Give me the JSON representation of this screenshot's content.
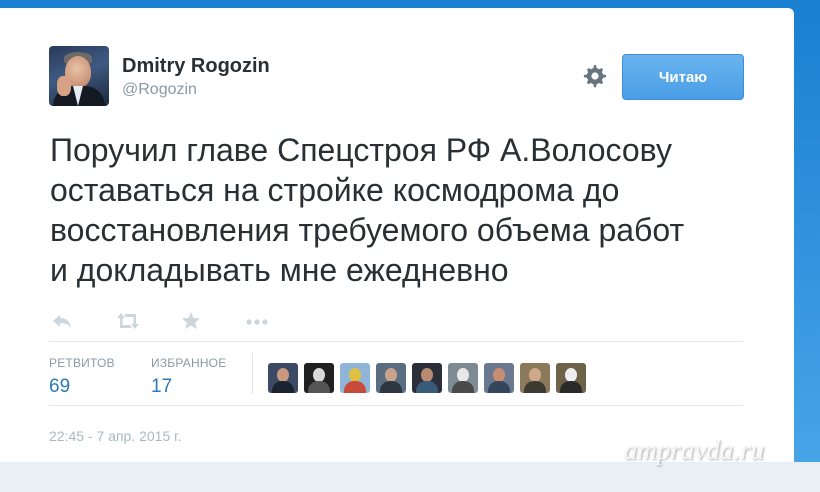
{
  "tweet": {
    "author_name": "Dmitry Rogozin",
    "author_handle": "@Rogozin",
    "follow_label": "Читаю",
    "text_lines": [
      "Поручил главе Спецстроя РФ А.Волосову",
      "оставаться на стройке космодрома до",
      "восстановления требуемого объема работ",
      "и докладывать мне ежедневно"
    ],
    "actions": [
      "reply-icon",
      "retweet-icon",
      "favorite-icon",
      "more-icon"
    ],
    "stats": {
      "retweets_label": "РЕТВИТОВ",
      "retweets_value": "69",
      "favorites_label": "ИЗБРАННОЕ",
      "favorites_value": "17"
    },
    "timestamp": "22:45 - 7 апр. 2015 г."
  },
  "watermark": "ampravda.ru",
  "colors": {
    "background_blue": "#2d8fdc",
    "card": "#ffffff",
    "text": "#292f33",
    "muted": "#8899a6",
    "link_blue": "#2b7bb9",
    "follow_button": "#55acee"
  }
}
